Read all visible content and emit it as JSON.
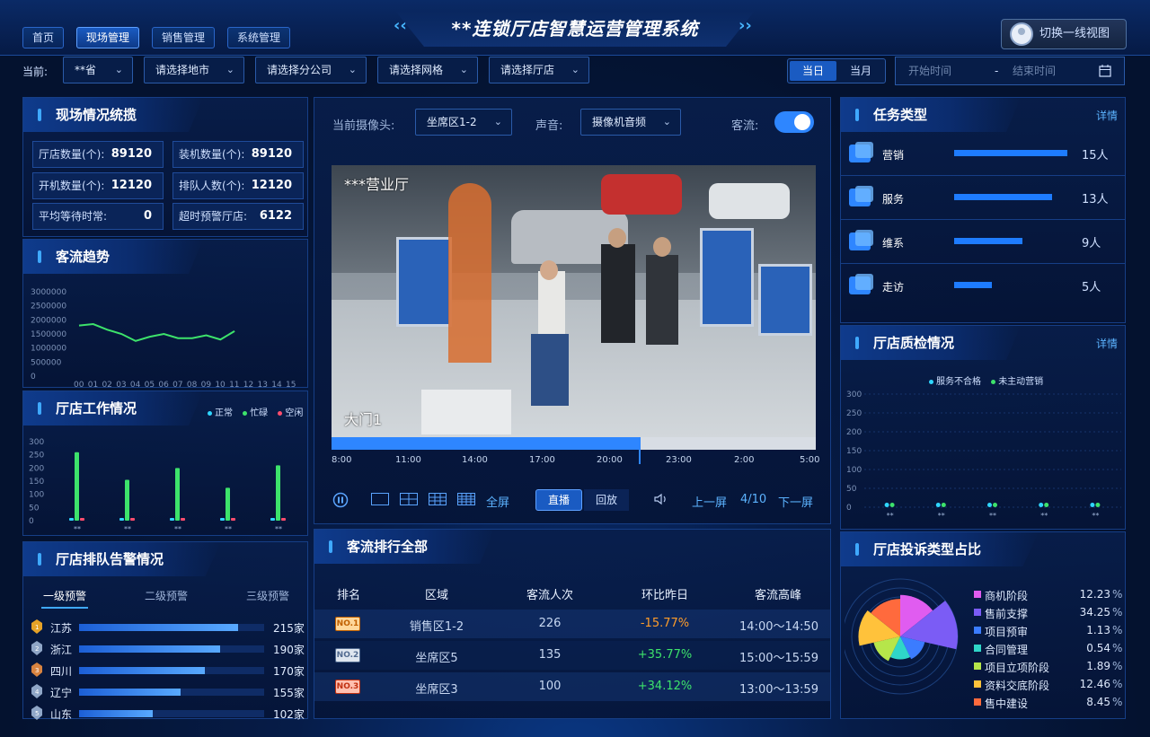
{
  "header": {
    "nav": [
      "首页",
      "现场管理",
      "销售管理",
      "系统管理"
    ],
    "title": "**连锁厅店智慧运营管理系统",
    "switch_label": "切换一线视图"
  },
  "filters": {
    "current_label": "当前:",
    "province": "**省",
    "city": "请选择地市",
    "branch": "请选择分公司",
    "grid": "请选择网格",
    "hall": "请选择厅店",
    "day": "当日",
    "month": "当月",
    "start_placeholder": "开始时间",
    "range_sep": "-",
    "end_placeholder": "结束时间"
  },
  "overview": {
    "title": "现场情况统揽",
    "stats": [
      {
        "label": "厅店数量(个):",
        "value": "89120"
      },
      {
        "label": "装机数量(个):",
        "value": "89120"
      },
      {
        "label": "开机数量(个):",
        "value": "12120"
      },
      {
        "label": "排队人数(个):",
        "value": "12120"
      },
      {
        "label": "平均等待时常:",
        "value": "0"
      },
      {
        "label": "超时预警厅店:",
        "value": "6122"
      }
    ]
  },
  "traffic_trend": {
    "title": "客流趋势",
    "chart_data": {
      "type": "line",
      "x": [
        "00",
        "01",
        "02",
        "03",
        "04",
        "05",
        "06",
        "07",
        "08",
        "09",
        "10",
        "11",
        "12",
        "13",
        "14",
        "15"
      ],
      "series": [
        {
          "values": [
            1800000,
            1850000,
            1650000,
            1500000,
            1250000,
            1400000,
            1500000,
            1350000,
            1350000,
            1450000,
            1300000,
            1600000
          ]
        }
      ],
      "ylim": [
        0,
        3000000
      ],
      "yticks": [
        "3000000",
        "2500000",
        "2000000",
        "1500000",
        "1000000",
        "500000",
        "0"
      ],
      "color": "#3de36b"
    }
  },
  "hall_work": {
    "title": "厅店工作情况",
    "chart_data": {
      "type": "bar",
      "categories": [
        "**",
        "**",
        "**",
        "**",
        "**"
      ],
      "series": [
        {
          "name": "正常",
          "values": [
            5,
            5,
            5,
            5,
            5
          ],
          "color": "#2fd6ff"
        },
        {
          "name": "忙碌",
          "values": [
            260,
            155,
            200,
            125,
            210
          ],
          "color": "#3de36b"
        },
        {
          "name": "空闲",
          "values": [
            5,
            5,
            5,
            5,
            5
          ],
          "color": "#ff4d6d"
        }
      ],
      "ylim": [
        0,
        300
      ],
      "yticks": [
        "300",
        "250",
        "200",
        "150",
        "100",
        "50",
        "0"
      ]
    }
  },
  "queue_alert": {
    "title": "厅店排队告警情况",
    "tabs": [
      "一级预警",
      "二级预警",
      "三级预警"
    ],
    "rows": [
      {
        "name": "江苏",
        "value": "215家",
        "pct": 0.86
      },
      {
        "name": "浙江",
        "value": "190家",
        "pct": 0.76
      },
      {
        "name": "四川",
        "value": "170家",
        "pct": 0.68
      },
      {
        "name": "辽宁",
        "value": "155家",
        "pct": 0.55
      },
      {
        "name": "山东",
        "value": "102家",
        "pct": 0.4
      }
    ]
  },
  "camera": {
    "camera_label": "当前摄像头:",
    "camera_value": "坐席区1-2",
    "audio_label": "声音:",
    "audio_value": "摄像机音频",
    "flow_label": "客流:",
    "overlay_top": "***营业厅",
    "overlay_bottom": "大门1",
    "timeline": [
      "8:00",
      "11:00",
      "14:00",
      "17:00",
      "20:00",
      "23:00",
      "2:00",
      "5:00"
    ],
    "fullscreen": "全屏",
    "live": "直播",
    "playback": "回放",
    "prev": "上一屏",
    "page": "4/10",
    "next": "下一屏"
  },
  "ranking": {
    "title": "客流排行全部",
    "headers": [
      "排名",
      "区域",
      "客流人次",
      "环比昨日",
      "客流高峰"
    ],
    "rows": [
      {
        "rank": "NO.1",
        "area": "销售区1-2",
        "count": "226",
        "change": "-15.77%",
        "peak": "14:00～14:50"
      },
      {
        "rank": "NO.2",
        "area": "坐席区5",
        "count": "135",
        "change": "+35.77%",
        "peak": "15:00～15:59"
      },
      {
        "rank": "NO.3",
        "area": "坐席区3",
        "count": "100",
        "change": "+34.12%",
        "peak": "13:00～13:59"
      }
    ]
  },
  "task_type": {
    "title": "任务类型",
    "detail": "详情",
    "rows": [
      {
        "name": "营销",
        "value": "15人",
        "n": 15
      },
      {
        "name": "服务",
        "value": "13人",
        "n": 13
      },
      {
        "name": "维系",
        "value": "9人",
        "n": 9
      },
      {
        "name": "走访",
        "value": "5人",
        "n": 5
      }
    ]
  },
  "quality": {
    "title": "厅店质检情况",
    "detail": "详情",
    "chart_data": {
      "type": "bar",
      "categories": [
        "**",
        "**",
        "**",
        "**",
        "**"
      ],
      "series": [
        {
          "name": "服务不合格",
          "values": [
            3,
            3,
            3,
            3,
            3
          ],
          "color": "#2fd6ff"
        },
        {
          "name": "未主动营销",
          "values": [
            3,
            3,
            3,
            3,
            3
          ],
          "color": "#3de36b"
        }
      ],
      "ylim": [
        0,
        300
      ],
      "yticks": [
        "300",
        "250",
        "200",
        "150",
        "100",
        "50",
        "0"
      ]
    }
  },
  "complaint": {
    "title": "厅店投诉类型占比",
    "chart_data": {
      "type": "pie",
      "slices": [
        {
          "name": "商机阶段",
          "value": 12.23,
          "color": "#e05cf0"
        },
        {
          "name": "售前支撑",
          "value": 34.25,
          "color": "#7b5cf5"
        },
        {
          "name": "项目预审",
          "value": 1.13,
          "color": "#3b7cff"
        },
        {
          "name": "合同管理",
          "value": 0.54,
          "color": "#2fd6c8"
        },
        {
          "name": "项目立项阶段",
          "value": 1.89,
          "color": "#b6e64a"
        },
        {
          "name": "资料交底阶段",
          "value": 12.46,
          "color": "#ffc23b"
        },
        {
          "name": "售中建设",
          "value": 8.45,
          "color": "#ff6a3d"
        }
      ],
      "unit": "%"
    }
  }
}
